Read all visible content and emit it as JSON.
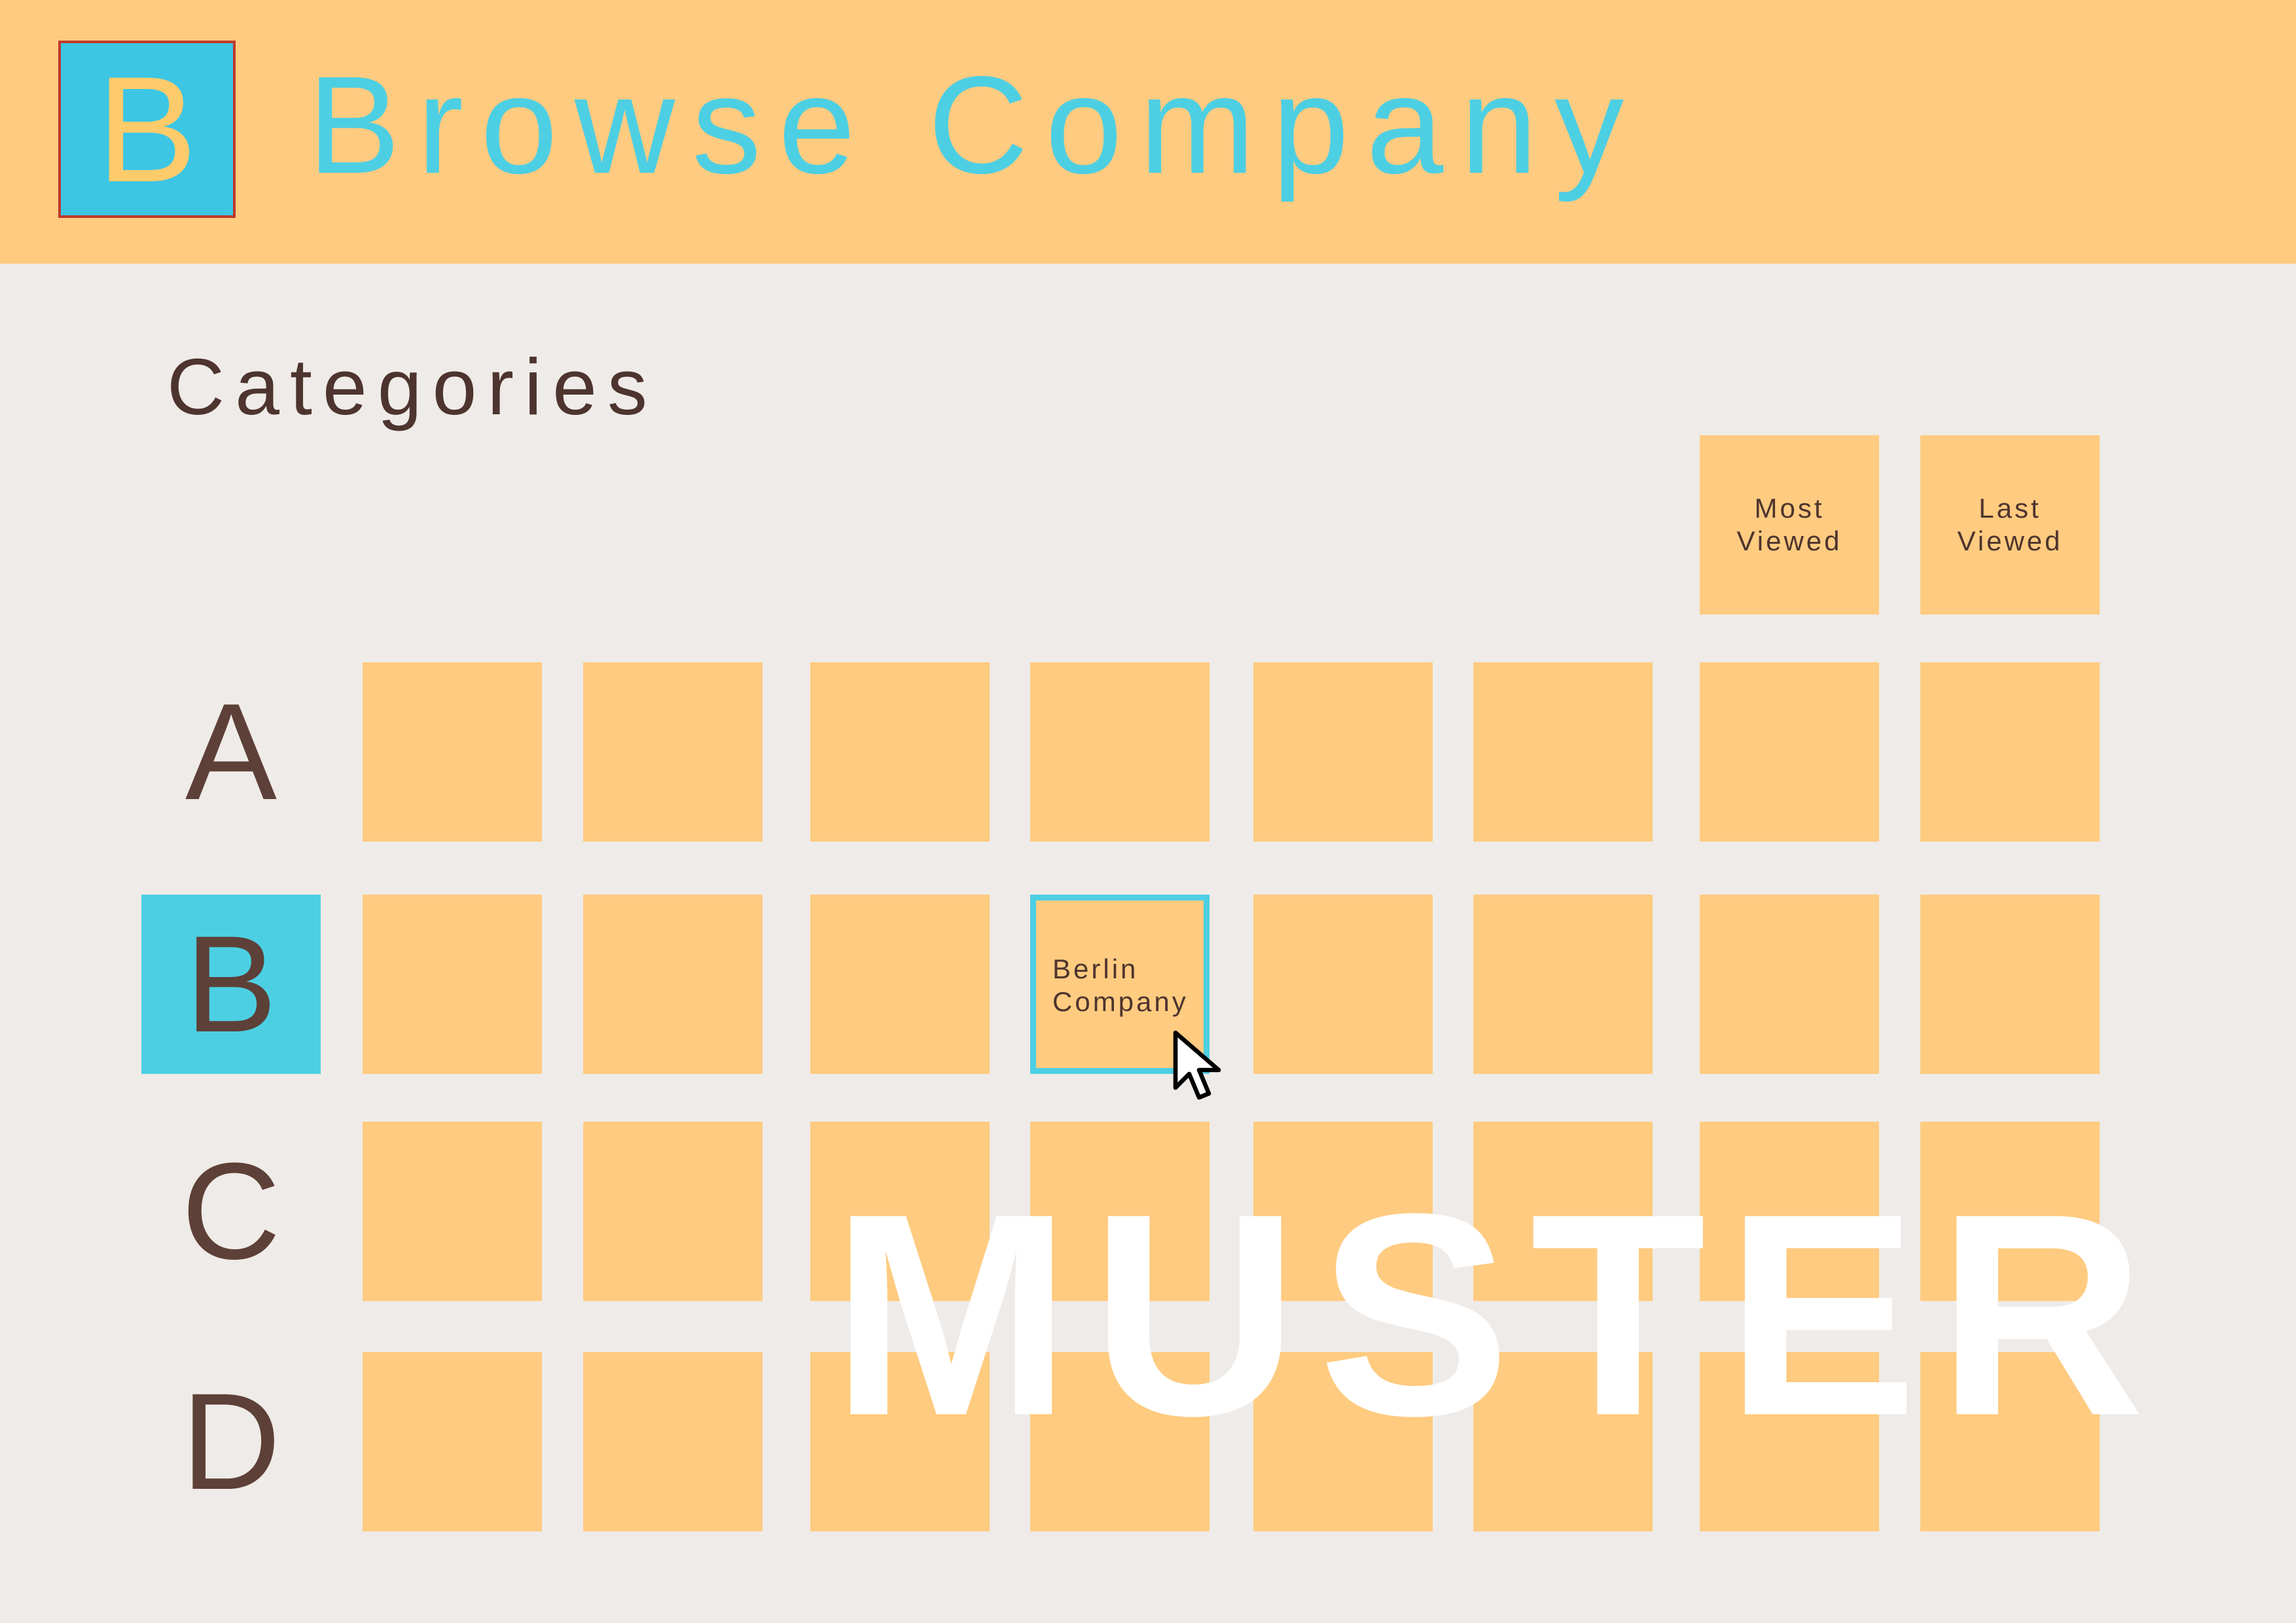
{
  "header": {
    "logo_letter": "B",
    "title": "Browse Company"
  },
  "section": {
    "heading": "Categories"
  },
  "quick_filters": [
    {
      "label": "Most\nViewed"
    },
    {
      "label": "Last\nViewed"
    }
  ],
  "rows": [
    {
      "letter": "A",
      "active": false,
      "tiles": [
        "",
        "",
        "",
        "",
        "",
        "",
        "",
        ""
      ]
    },
    {
      "letter": "B",
      "active": true,
      "tiles": [
        "",
        "",
        "",
        "Berlin\nCompany",
        "",
        "",
        "",
        ""
      ]
    },
    {
      "letter": "C",
      "active": false,
      "tiles": [
        "",
        "",
        "",
        "",
        "",
        "",
        "",
        ""
      ]
    },
    {
      "letter": "D",
      "active": false,
      "tiles": [
        "",
        "",
        "",
        "",
        "",
        "",
        "",
        ""
      ]
    }
  ],
  "selected_tile": {
    "row": "B",
    "column": 4,
    "label": "Berlin\nCompany"
  },
  "watermark": "MUSTER",
  "colors": {
    "header_bg": "#fecb80",
    "accent": "#4dcfe3",
    "tile": "#fecb80",
    "text_dark": "#4e342e",
    "page_bg": "#efebe8"
  },
  "icons": {
    "cursor": "mouse-pointer-icon"
  }
}
